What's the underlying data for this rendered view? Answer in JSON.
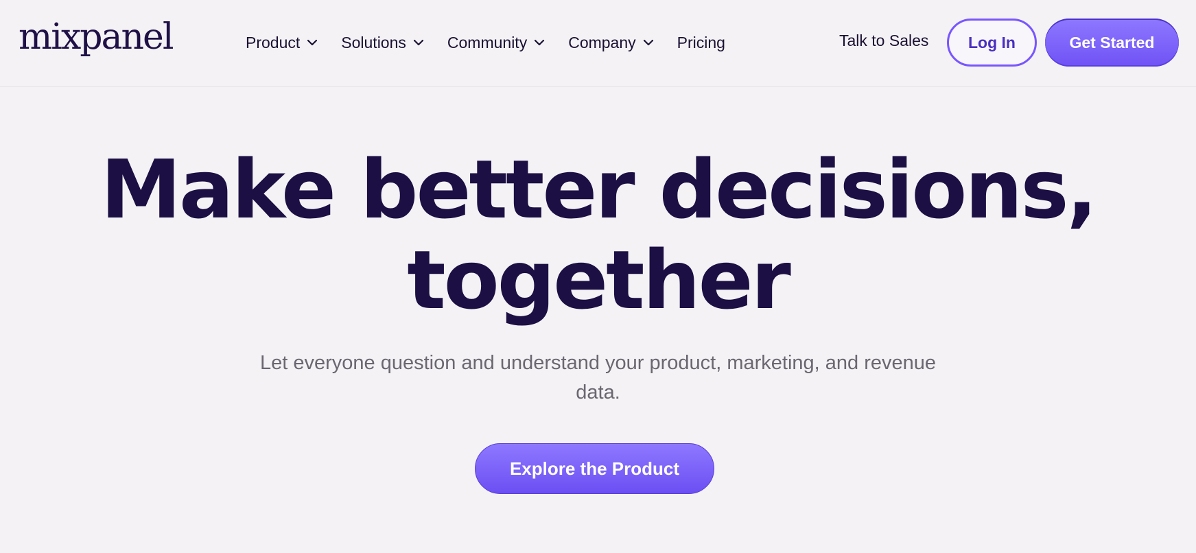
{
  "header": {
    "logo_text": "mixpanel",
    "nav": [
      {
        "label": "Product",
        "has_dropdown": true
      },
      {
        "label": "Solutions",
        "has_dropdown": true
      },
      {
        "label": "Community",
        "has_dropdown": true
      },
      {
        "label": "Company",
        "has_dropdown": true
      },
      {
        "label": "Pricing",
        "has_dropdown": false
      }
    ],
    "talk_to_sales": "Talk to Sales",
    "login_label": "Log In",
    "get_started_label": "Get Started"
  },
  "hero": {
    "title_line1": "Make better decisions,",
    "title_line2": "together",
    "subtitle": "Let everyone question and understand your product, marketing, and revenue data.",
    "cta_label": "Explore the Product"
  },
  "colors": {
    "background": "#f4f2f4",
    "brand_purple": "#7856ff",
    "heading": "#1b0f44",
    "muted_text": "#6b6771"
  },
  "icons": {
    "nav_dropdown": "chevron-down-icon"
  }
}
